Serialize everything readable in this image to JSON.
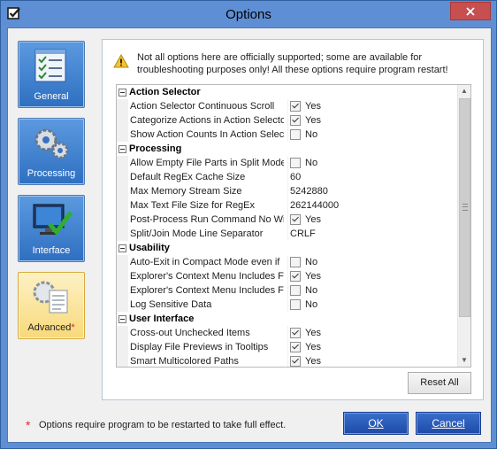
{
  "window": {
    "title": "Options",
    "app_icon": "checkbox-app-icon",
    "close_icon": "close-icon"
  },
  "sidebar": {
    "items": [
      {
        "label": "General",
        "icon": "checklist-icon",
        "active": false
      },
      {
        "label": "Processing",
        "icon": "gears-icon",
        "active": false
      },
      {
        "label": "Interface",
        "icon": "monitor-check-icon",
        "active": false
      },
      {
        "label": "Advanced",
        "icon": "gear-document-icon",
        "active": true,
        "marker": "*"
      }
    ]
  },
  "notice": {
    "icon": "warning-icon",
    "text": "Not all options here are officially supported; some are available for troubleshooting purposes only! All these options require program restart!"
  },
  "grid": {
    "categories": [
      {
        "name": "Action Selector",
        "props": [
          {
            "name": "Action Selector Continuous Scroll",
            "type": "bool",
            "checked": true,
            "value": "Yes"
          },
          {
            "name": "Categorize Actions in Action Selecto",
            "type": "bool",
            "checked": true,
            "value": "Yes"
          },
          {
            "name": "Show Action Counts In Action Select",
            "type": "bool",
            "checked": false,
            "value": "No"
          }
        ]
      },
      {
        "name": "Processing",
        "props": [
          {
            "name": "Allow Empty File Parts in Split Mode",
            "type": "bool",
            "checked": false,
            "value": "No"
          },
          {
            "name": "Default RegEx Cache Size",
            "type": "text",
            "value": "60"
          },
          {
            "name": "Max Memory Stream Size",
            "type": "text",
            "value": "5242880"
          },
          {
            "name": "Max Text File Size for RegEx",
            "type": "text",
            "value": "262144000"
          },
          {
            "name": "Post-Process Run Command No Wi",
            "type": "bool",
            "checked": true,
            "value": "Yes"
          },
          {
            "name": "Split/Join Mode Line Separator",
            "type": "text",
            "value": "CRLF"
          }
        ]
      },
      {
        "name": "Usability",
        "props": [
          {
            "name": "Auto-Exit in Compact Mode even if",
            "type": "bool",
            "checked": false,
            "value": "No"
          },
          {
            "name": "Explorer's Context Menu Includes F",
            "type": "bool",
            "checked": true,
            "value": "Yes"
          },
          {
            "name": "Explorer's Context Menu Includes F",
            "type": "bool",
            "checked": false,
            "value": "No"
          },
          {
            "name": "Log Sensitive Data",
            "type": "bool",
            "checked": false,
            "value": "No"
          }
        ]
      },
      {
        "name": "User Interface",
        "props": [
          {
            "name": "Cross-out Unchecked Items",
            "type": "bool",
            "checked": true,
            "value": "Yes"
          },
          {
            "name": "Display File Previews in Tooltips",
            "type": "bool",
            "checked": true,
            "value": "Yes"
          },
          {
            "name": "Smart Multicolored Paths",
            "type": "bool",
            "checked": true,
            "value": "Yes"
          }
        ]
      }
    ]
  },
  "buttons": {
    "reset": "Reset All",
    "ok": "OK",
    "cancel": "Cancel"
  },
  "footnote": {
    "marker": "*",
    "text": "Options require program to be restarted to take full effect."
  },
  "colors": {
    "title_bar": "#5e8fd5",
    "nav_button": "#2e6fc0",
    "nav_active": "#f8d97b",
    "dialog_button": "#1d4aa7",
    "asterisk": "#e0262c"
  }
}
